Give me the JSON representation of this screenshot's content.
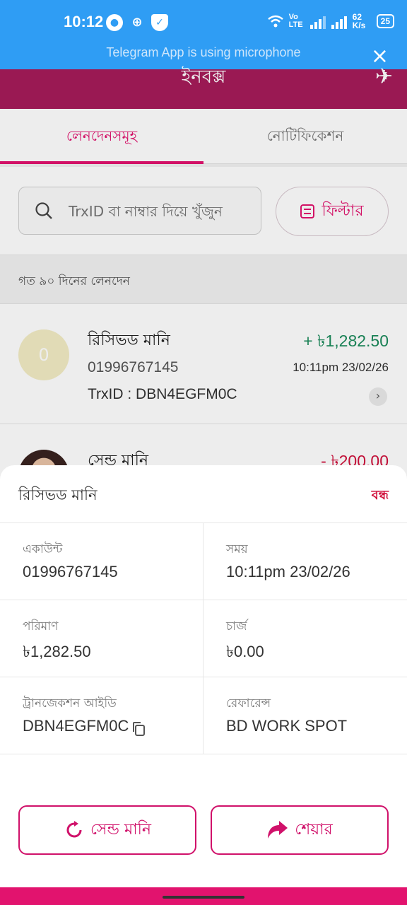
{
  "status_bar": {
    "time": "10:12",
    "network_type": "Vo LTE",
    "speed": "62 K/s",
    "battery": "25"
  },
  "mic_banner": {
    "text": "Telegram App is using microphone"
  },
  "app": {
    "title": "ইনবক্স",
    "tabs": [
      {
        "label": "লেনদেনসমূহ",
        "active": true
      },
      {
        "label": "নোটিফিকেশন",
        "active": false
      }
    ],
    "search": {
      "placeholder": "TrxID বা নাম্বার দিয়ে খুঁজুন"
    },
    "filter_label": "ফিল্টার",
    "section_label": "গত ৯০ দিনের লেনদেন",
    "transactions": [
      {
        "title": "রিসিভড মানি",
        "avatar_text": "0",
        "number": "01996767145",
        "trx": "TrxID : DBN4EGFM0C",
        "amount": "+ ৳1,282.50",
        "time": "10:11pm 23/02/26",
        "direction": "in"
      },
      {
        "title": "সেন্ড মানি",
        "amount": "- ৳200.00",
        "direction": "out"
      }
    ]
  },
  "sheet": {
    "title": "রিসিভড মানি",
    "close_label": "বন্ধ",
    "fields": [
      {
        "label": "একাউন্ট",
        "value": "01996767145"
      },
      {
        "label": "সময়",
        "value": "10:11pm 23/02/26"
      },
      {
        "label": "পরিমাণ",
        "value": "৳1,282.50"
      },
      {
        "label": "চার্জ",
        "value": "৳0.00"
      },
      {
        "label": "ট্রানজেকশন আইডি",
        "value": "DBN4EGFM0C"
      },
      {
        "label": "রেফারেন্স",
        "value": "BD WORK SPOT"
      }
    ],
    "send_money_label": "সেন্ড মানি",
    "share_label": "শেয়ার"
  },
  "colors": {
    "status_bar": "#2f9df4",
    "brand": "#e2136e",
    "income": "#1a8a5b",
    "expense": "#d0113c"
  },
  "icons": [
    "mic-icon",
    "gamepad-icon",
    "shield-icon",
    "wifi-icon",
    "signal-icon",
    "battery-icon",
    "close-icon",
    "search-icon",
    "filter-icon",
    "chevron-right-icon",
    "copy-icon",
    "refresh-icon",
    "share-icon"
  ]
}
